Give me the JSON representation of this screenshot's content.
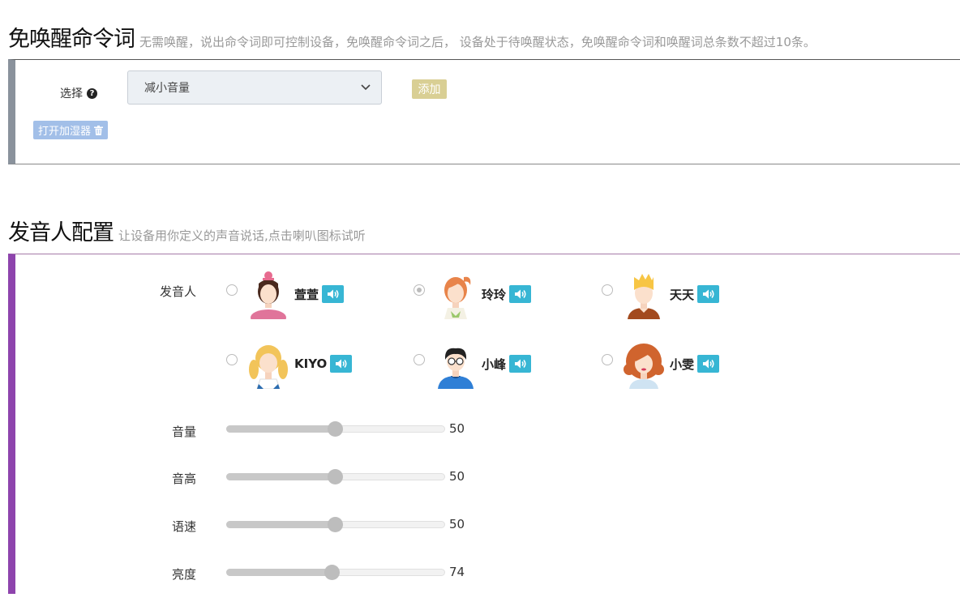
{
  "wakeless": {
    "title": "免唤醒命令词",
    "subtitle": "无需唤醒，说出命令词即可控制设备，免唤醒命令词之后， 设备处于待唤醒状态，免唤醒命令词和唤醒词总条数不超过10条。",
    "select_label": "选择",
    "select_value": "减小音量",
    "add_label": "添加",
    "tags": [
      "打开加湿器"
    ]
  },
  "speaker_config": {
    "title": "发音人配置",
    "subtitle": "让设备用你定义的声音说话,点击喇叭图标试听",
    "voice_label": "发音人",
    "voices": [
      {
        "name": "萱萱",
        "checked": false,
        "icon": "girl-bun-avatar"
      },
      {
        "name": "玲玲",
        "checked": true,
        "icon": "girl-orange-hair-avatar"
      },
      {
        "name": "天天",
        "checked": false,
        "icon": "boy-blond-avatar"
      },
      {
        "name": "KIYO",
        "checked": false,
        "icon": "girl-blonde-pigtails-avatar"
      },
      {
        "name": "小峰",
        "checked": false,
        "icon": "boy-glasses-avatar"
      },
      {
        "name": "小雯",
        "checked": false,
        "icon": "woman-curly-hair-avatar"
      }
    ],
    "sliders": [
      {
        "label": "音量",
        "value": 50,
        "max": 100
      },
      {
        "label": "音高",
        "value": 50,
        "max": 100
      },
      {
        "label": "语速",
        "value": 50,
        "max": 100
      },
      {
        "label": "亮度",
        "value": 74,
        "max": 100
      }
    ]
  },
  "colors": {
    "panel1_accent": "#8a929c",
    "panel2_accent": "#8e44ad",
    "add_button": "#d9cf94",
    "tag": "#a2bfe8",
    "speaker_button": "#37b6d4"
  }
}
